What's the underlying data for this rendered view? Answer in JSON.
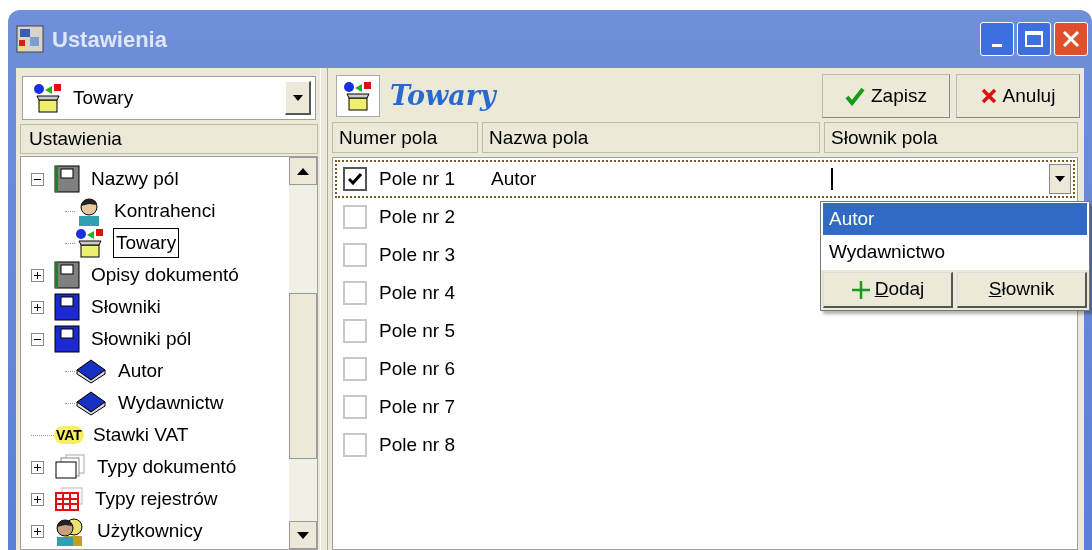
{
  "window": {
    "title": "Ustawienia"
  },
  "left_panel": {
    "combo": {
      "value": "Towary"
    },
    "header": "Ustawienia",
    "tree": [
      {
        "label": "Nazwy pól",
        "kind": "record",
        "expanded": true,
        "selected": false,
        "children": [
          {
            "label": "Kontrahenci",
            "kind": "contact",
            "selected": false
          },
          {
            "label": "Towary",
            "kind": "product",
            "selected": true
          }
        ]
      },
      {
        "label": "Opisy dokumentó",
        "kind": "record",
        "expanded": false,
        "selected": false
      },
      {
        "label": "Słowniki",
        "kind": "dictionary",
        "expanded": false,
        "selected": false
      },
      {
        "label": "Słowniki pól",
        "kind": "dictionary",
        "expanded": true,
        "selected": false,
        "children": [
          {
            "label": "Autor",
            "kind": "book",
            "selected": false
          },
          {
            "label": "Wydawnictw",
            "kind": "book",
            "selected": false
          }
        ]
      },
      {
        "label": "Stawki VAT",
        "kind": "badge",
        "badge": "VAT",
        "selected": false
      },
      {
        "label": "Typy dokumentó",
        "kind": "documents",
        "expanded": false,
        "selected": false
      },
      {
        "label": "Typy rejestrów",
        "kind": "registers",
        "expanded": false,
        "selected": false
      },
      {
        "label": "Użytkownicy",
        "kind": "users",
        "expanded": false,
        "selected": false
      }
    ]
  },
  "right_panel": {
    "title": "Towary",
    "buttons": [
      {
        "kind": "save",
        "label": "Zapisz"
      },
      {
        "kind": "cancel",
        "label": "Anuluj"
      }
    ],
    "table": {
      "columns": [
        "Numer pola",
        "Nazwa pola",
        "Słownik pola"
      ],
      "rows": [
        {
          "checked": true,
          "number": "Pole nr 1",
          "name": "Autor",
          "focused": true
        },
        {
          "checked": false,
          "number": "Pole nr 2",
          "focused": false
        },
        {
          "checked": false,
          "number": "Pole nr 3",
          "focused": false
        },
        {
          "checked": false,
          "number": "Pole nr 4",
          "focused": false
        },
        {
          "checked": false,
          "number": "Pole nr 5",
          "focused": false
        },
        {
          "checked": false,
          "number": "Pole nr 6",
          "focused": false
        },
        {
          "checked": false,
          "number": "Pole nr 7",
          "focused": false
        },
        {
          "checked": false,
          "number": "Pole nr 8",
          "focused": false
        }
      ]
    },
    "dropdown": {
      "items": [
        {
          "label": "Autor",
          "selected": true
        },
        {
          "label": "Wydawnictwo",
          "selected": false
        }
      ],
      "buttons": [
        {
          "kind": "add",
          "label": "Dodaj"
        },
        {
          "kind": "dictionary",
          "label": "Słownik"
        }
      ]
    }
  }
}
